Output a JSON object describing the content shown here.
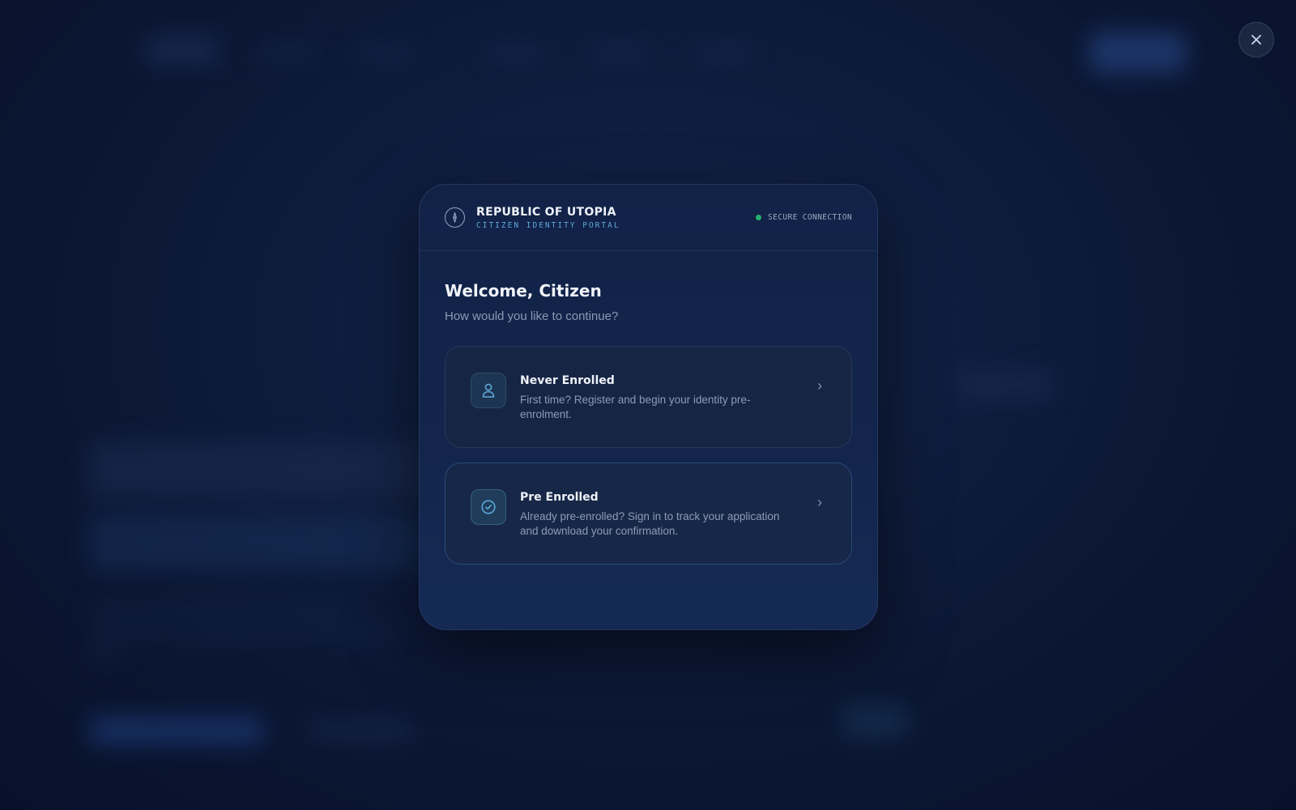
{
  "header": {
    "title": "REPUBLIC OF UTOPIA",
    "subtitle": "CITIZEN IDENTITY PORTAL",
    "status": "SECURE CONNECTION"
  },
  "main": {
    "heading": "Welcome, Citizen",
    "prompt": "How would you like to continue?",
    "options": [
      {
        "title": "Never Enrolled",
        "description": "First time? Register and begin your identity pre-enrolment.",
        "icon": "user-icon"
      },
      {
        "title": "Pre Enrolled",
        "description": "Already pre-enrolled? Sign in to track your application and download your confirmation.",
        "icon": "check-circle-icon"
      }
    ]
  },
  "close_icon": "close-icon",
  "colors": {
    "accent": "#5fa7da",
    "status_dot": "#27b06a",
    "modal_bg": "#13254c",
    "page_bg": "#0b1630"
  }
}
